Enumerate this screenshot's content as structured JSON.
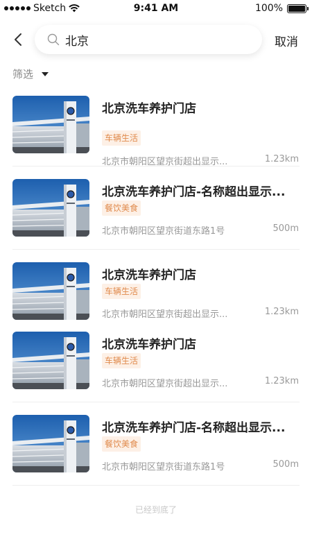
{
  "status_bar": {
    "carrier": "Sketch",
    "time": "9:41 AM",
    "battery": "100%"
  },
  "search": {
    "value": "北京",
    "cancel_label": "取消"
  },
  "filter": {
    "label": "筛选"
  },
  "results": [
    {
      "title": "北京洗车养护门店",
      "tag": "车辆生活",
      "address": "北京市朝阳区望京街超出显示...",
      "distance": "1.23km"
    },
    {
      "title": "北京洗车养护门店-名称超出显示...",
      "tag": "餐饮美食",
      "address": "北京市朝阳区望京街道东路1号",
      "distance": "500m"
    },
    {
      "title": "北京洗车养护门店",
      "tag": "车辆生活",
      "address": "北京市朝阳区望京街超出显示...",
      "distance": "1.23km"
    },
    {
      "title": "北京洗车养护门店",
      "tag": "车辆生活",
      "address": "北京市朝阳区望京街超出显示...",
      "distance": "1.23km"
    },
    {
      "title": "北京洗车养护门店-名称超出显示...",
      "tag": "餐饮美食",
      "address": "北京市朝阳区望京街道东路1号",
      "distance": "500m"
    }
  ],
  "end_text": "已经到底了",
  "colors": {
    "tag_text": "#e08a4c",
    "tag_bg": "#fdf0e6",
    "secondary_text": "#999999"
  },
  "icons": [
    "back-chevron-icon",
    "search-icon",
    "caret-down-icon",
    "wifi-icon",
    "battery-icon"
  ]
}
